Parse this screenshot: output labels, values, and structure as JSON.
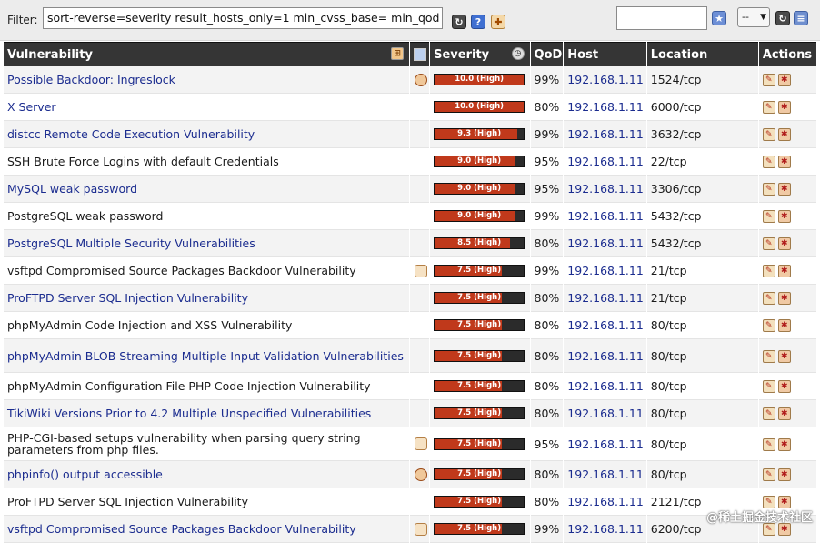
{
  "filter": {
    "label": "Filter:",
    "value": "sort-reverse=severity result_hosts_only=1 min_cvss_base= min_qod"
  },
  "select": {
    "value": "--"
  },
  "columns": {
    "vulnerability": "Vulnerability",
    "severity": "Severity",
    "qod": "QoD",
    "host": "Host",
    "location": "Location",
    "actions": "Actions"
  },
  "severity_max": 10,
  "rows": [
    {
      "name": "Possible Backdoor: Ingreslock",
      "link": true,
      "qod_icon": "round",
      "severity": 10.0,
      "severity_label": "10.0 (High)",
      "qod": "99%",
      "host": "192.168.1.11",
      "location": "1524/tcp"
    },
    {
      "name": "X Server",
      "link": true,
      "qod_icon": "",
      "severity": 10.0,
      "severity_label": "10.0 (High)",
      "qod": "80%",
      "host": "192.168.1.11",
      "location": "6000/tcp"
    },
    {
      "name": "distcc Remote Code Execution Vulnerability",
      "link": true,
      "qod_icon": "",
      "severity": 9.3,
      "severity_label": "9.3 (High)",
      "qod": "99%",
      "host": "192.168.1.11",
      "location": "3632/tcp"
    },
    {
      "name": "SSH Brute Force Logins with default Credentials",
      "link": false,
      "qod_icon": "",
      "severity": 9.0,
      "severity_label": "9.0 (High)",
      "qod": "95%",
      "host": "192.168.1.11",
      "location": "22/tcp"
    },
    {
      "name": "MySQL weak password",
      "link": true,
      "qod_icon": "",
      "severity": 9.0,
      "severity_label": "9.0 (High)",
      "qod": "95%",
      "host": "192.168.1.11",
      "location": "3306/tcp"
    },
    {
      "name": "PostgreSQL weak password",
      "link": false,
      "qod_icon": "",
      "severity": 9.0,
      "severity_label": "9.0 (High)",
      "qod": "99%",
      "host": "192.168.1.11",
      "location": "5432/tcp"
    },
    {
      "name": "PostgreSQL Multiple Security Vulnerabilities",
      "link": true,
      "qod_icon": "",
      "severity": 8.5,
      "severity_label": "8.5 (High)",
      "qod": "80%",
      "host": "192.168.1.11",
      "location": "5432/tcp"
    },
    {
      "name": "vsftpd Compromised Source Packages Backdoor Vulnerability",
      "link": false,
      "qod_icon": "square",
      "severity": 7.5,
      "severity_label": "7.5 (High)",
      "qod": "99%",
      "host": "192.168.1.11",
      "location": "21/tcp"
    },
    {
      "name": "ProFTPD Server SQL Injection Vulnerability",
      "link": true,
      "qod_icon": "",
      "severity": 7.5,
      "severity_label": "7.5 (High)",
      "qod": "80%",
      "host": "192.168.1.11",
      "location": "21/tcp"
    },
    {
      "name": "phpMyAdmin Code Injection and XSS Vulnerability",
      "link": false,
      "qod_icon": "",
      "severity": 7.5,
      "severity_label": "7.5 (High)",
      "qod": "80%",
      "host": "192.168.1.11",
      "location": "80/tcp"
    },
    {
      "name": "phpMyAdmin BLOB Streaming Multiple Input Validation Vulnerabilities",
      "link": true,
      "tall": true,
      "qod_icon": "",
      "severity": 7.5,
      "severity_label": "7.5 (High)",
      "qod": "80%",
      "host": "192.168.1.11",
      "location": "80/tcp"
    },
    {
      "name": "phpMyAdmin Configuration File PHP Code Injection Vulnerability",
      "link": false,
      "qod_icon": "",
      "severity": 7.5,
      "severity_label": "7.5 (High)",
      "qod": "80%",
      "host": "192.168.1.11",
      "location": "80/tcp"
    },
    {
      "name": "TikiWiki Versions Prior to 4.2 Multiple Unspecified Vulnerabilities",
      "link": true,
      "qod_icon": "",
      "severity": 7.5,
      "severity_label": "7.5 (High)",
      "qod": "80%",
      "host": "192.168.1.11",
      "location": "80/tcp"
    },
    {
      "name": "PHP-CGI-based setups vulnerability when parsing query string parameters from php files.",
      "link": false,
      "tall": true,
      "qod_icon": "square",
      "severity": 7.5,
      "severity_label": "7.5 (High)",
      "qod": "95%",
      "host": "192.168.1.11",
      "location": "80/tcp"
    },
    {
      "name": "phpinfo() output accessible",
      "link": true,
      "qod_icon": "round",
      "severity": 7.5,
      "severity_label": "7.5 (High)",
      "qod": "80%",
      "host": "192.168.1.11",
      "location": "80/tcp"
    },
    {
      "name": "ProFTPD Server SQL Injection Vulnerability",
      "link": false,
      "qod_icon": "",
      "severity": 7.5,
      "severity_label": "7.5 (High)",
      "qod": "80%",
      "host": "192.168.1.11",
      "location": "2121/tcp"
    },
    {
      "name": "vsftpd Compromised Source Packages Backdoor Vulnerability",
      "link": true,
      "qod_icon": "square",
      "severity": 7.5,
      "severity_label": "7.5 (High)",
      "qod": "99%",
      "host": "192.168.1.11",
      "location": "6200/tcp"
    }
  ],
  "watermark": "@稀土掘金技术社区"
}
